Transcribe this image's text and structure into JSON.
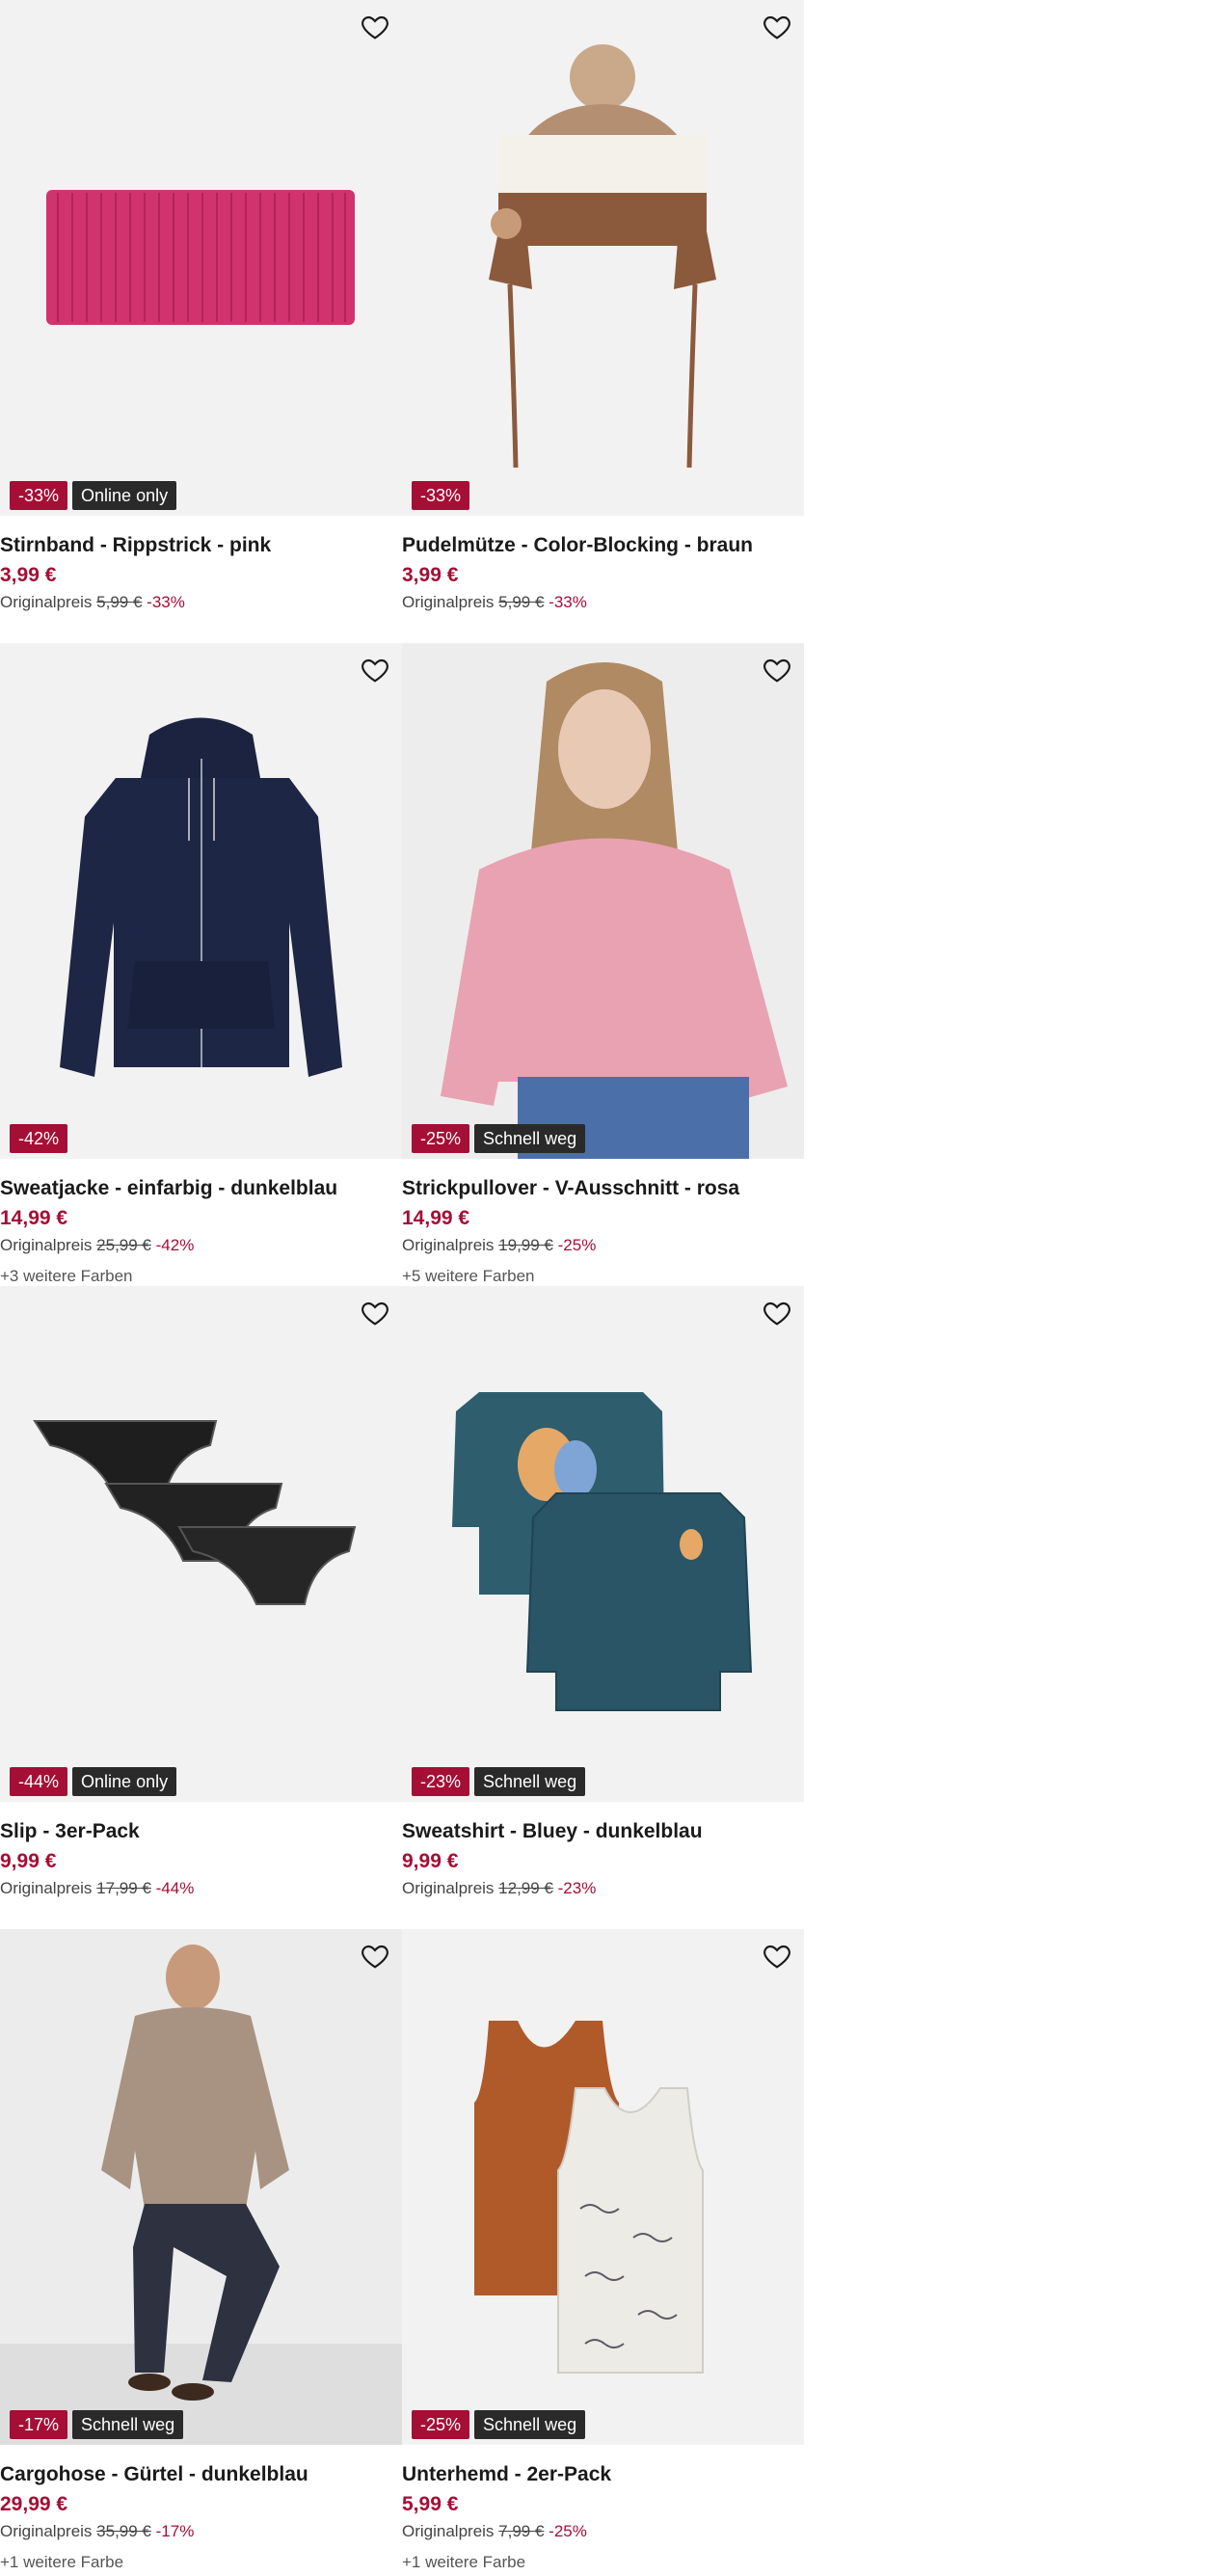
{
  "products": [
    {
      "title": "Stirnband - Rippstrick - pink",
      "price": "3,99 €",
      "original_label": "Originalpreis",
      "original_price": "5,99 €",
      "discount": "-33%",
      "badges": [
        "-33%",
        "Online only"
      ],
      "colors_text": ""
    },
    {
      "title": "Pudelmütze - Color-Blocking - braun",
      "price": "3,99 €",
      "original_label": "Originalpreis",
      "original_price": "5,99 €",
      "discount": "-33%",
      "badges": [
        "-33%"
      ],
      "colors_text": ""
    },
    {
      "title": "Sweatjacke - einfarbig - dunkelblau",
      "price": "14,99 €",
      "original_label": "Originalpreis",
      "original_price": "25,99 €",
      "discount": "-42%",
      "badges": [
        "-42%"
      ],
      "colors_text": "+3 weitere Farben"
    },
    {
      "title": "Strickpullover - V-Ausschnitt - rosa",
      "price": "14,99 €",
      "original_label": "Originalpreis",
      "original_price": "19,99 €",
      "discount": "-25%",
      "badges": [
        "-25%",
        "Schnell weg"
      ],
      "colors_text": "+5 weitere Farben"
    },
    {
      "title": "Slip - 3er-Pack",
      "price": "9,99 €",
      "original_label": "Originalpreis",
      "original_price": "17,99 €",
      "discount": "-44%",
      "badges": [
        "-44%",
        "Online only"
      ],
      "colors_text": ""
    },
    {
      "title": "Sweatshirt - Bluey - dunkelblau",
      "price": "9,99 €",
      "original_label": "Originalpreis",
      "original_price": "12,99 €",
      "discount": "-23%",
      "badges": [
        "-23%",
        "Schnell weg"
      ],
      "colors_text": ""
    },
    {
      "title": "Cargohose - Gürtel - dunkelblau",
      "price": "29,99 €",
      "original_label": "Originalpreis",
      "original_price": "35,99 €",
      "discount": "-17%",
      "badges": [
        "-17%",
        "Schnell weg"
      ],
      "colors_text": "+1 weitere Farbe"
    },
    {
      "title": "Unterhemd - 2er-Pack",
      "price": "5,99 €",
      "original_label": "Originalpreis",
      "original_price": "7,99 €",
      "discount": "-25%",
      "badges": [
        "-25%",
        "Schnell weg"
      ],
      "colors_text": "+1 weitere Farbe"
    }
  ],
  "icons": {
    "favorite": "heart-outline-icon"
  },
  "colors": {
    "sale": "#a50e35",
    "badge_dark": "#2a2a2a",
    "image_bg": "#f2f2f2"
  }
}
